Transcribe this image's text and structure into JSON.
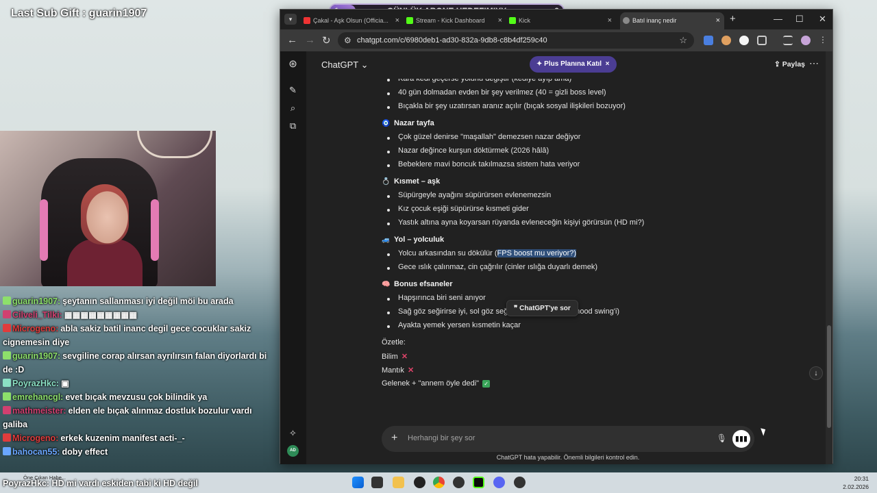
{
  "overlay": {
    "last_sub": "Last Sub Gift : guarin1907",
    "goal_title": "GÜNLÜK ABONE HEDEFIMIYY",
    "goal_current": "1",
    "goal_target": "9",
    "goal_progress": 0.11
  },
  "stream_chat": [
    {
      "user": "guarin1907:",
      "text": "şeytanın sallanması iyi değil möi bu arada",
      "color": "#8de06b"
    },
    {
      "user": "Cilveli_Tilki:",
      "text": "▦▦▦▦▦▦▦▦▦",
      "color": "#d14070"
    },
    {
      "user": "Microgeno:",
      "text": "abla sakiz batil inanc degil gece cocuklar sakiz cignemesin diye",
      "color": "#e03c3c"
    },
    {
      "user": "guarin1907:",
      "text": "sevgiline corap alırsan ayrılırsın falan diyorlardı bi de :D",
      "color": "#8de06b"
    },
    {
      "user": "PoyrazHkc:",
      "text": "▣",
      "color": "#8be0c4"
    },
    {
      "user": "emrehancgl:",
      "text": "evet bıçak mevzusu çok bilindik ya",
      "color": "#8de06b"
    },
    {
      "user": "mathmeister:",
      "text": "elden ele bıçak alınmaz dostluk bozulur vardı galiba",
      "color": "#d14070"
    },
    {
      "user": "Microgeno:",
      "text": "erkek kuzenim manifest acti-_-",
      "color": "#e03c3c"
    },
    {
      "user": "bahocan55:",
      "text": "doby effect",
      "color": "#6aa6ff"
    }
  ],
  "ticker": "PoyrazHkc: HD mi vardı eskiden tabi ki HD değil",
  "browser": {
    "tabs": [
      {
        "label": "Çakal - Aşk Olsun (Officia...",
        "color": "#e33"
      },
      {
        "label": "Stream - Kick Dashboard",
        "color": "#53fc18"
      },
      {
        "label": "Kick",
        "color": "#53fc18"
      },
      {
        "label": "Batıl inanç nedir",
        "color": "#8a8a8a"
      }
    ],
    "url": "chatgpt.com/c/6980deb1-ad30-832a-9db8-c8b4df259c40"
  },
  "chatgpt": {
    "model": "ChatGPT",
    "upgrade": "Plus Planına Katıl",
    "share": "Paylaş",
    "tooltip": "ChatGPT'ye sor",
    "composer_placeholder": "Herhangi bir şey sor",
    "disclaimer": "ChatGPT hata yapabilir. Önemli bilgileri kontrol edin.",
    "lines": [
      {
        "kind": "bullet",
        "text": "Kara kedi geçerse yolunu değiştir (kediye ayıp ama)"
      },
      {
        "kind": "bullet",
        "text": "40 gün dolmadan evden bir şey verilmez (40 = gizli boss level)"
      },
      {
        "kind": "bullet",
        "text": "Bıçakla bir şey uzatırsan aranız açılır (bıçak sosyal ilişkileri bozuyor)"
      },
      {
        "kind": "heading",
        "icon": "🧿",
        "text": "Nazar tayfa"
      },
      {
        "kind": "bullet",
        "text": "Çok güzel denirse \"maşallah\" demezsen nazar değiyor"
      },
      {
        "kind": "bullet",
        "text": "Nazar değince kurşun döktürmek (2026 hâlâ)"
      },
      {
        "kind": "bullet",
        "text": "Bebeklere mavi boncuk takılmazsa sistem hata veriyor"
      },
      {
        "kind": "heading",
        "icon": "💍",
        "text": "Kısmet – aşk"
      },
      {
        "kind": "bullet",
        "text": "Süpürgeyle ayağını süpürürsen evlenemezsin"
      },
      {
        "kind": "bullet",
        "text": "Kız çocuk eşiği süpürürse kısmeti gider"
      },
      {
        "kind": "bullet",
        "text": "Yastık altına ayna koyarsan rüyanda evleneceğin kişiyi görürsün (HD mi?)"
      },
      {
        "kind": "heading",
        "icon": "🚙",
        "text": "Yol – yolculuk"
      },
      {
        "kind": "bullet",
        "text": "Yolcu arkasından su dökülür (",
        "selected": "FPS boost mu veriyor?)"
      },
      {
        "kind": "bullet",
        "text": "Gece ıslık çalınmaz, cin çağrılır (cinler ıslığa duyarlı demek)"
      },
      {
        "kind": "heading",
        "icon": "🧠",
        "text": "Bonus efsaneler"
      },
      {
        "kind": "bullet",
        "text": "Hapşırınca biri seni anıyor"
      },
      {
        "kind": "bullet",
        "text": "Sağ göz seğirirse iyi, sol göz seğirirse kötü (gözlerin mood swing'i)"
      },
      {
        "kind": "bullet",
        "text": "Ayakta yemek yersen kısmetin kaçar"
      },
      {
        "kind": "plain",
        "text": "Özetle:"
      },
      {
        "kind": "plain",
        "text": "Bilim",
        "mark": "✕"
      },
      {
        "kind": "plain",
        "text": "Mantık",
        "mark": "✕"
      },
      {
        "kind": "plain",
        "text": "Gelenek + \"annem öyle dedi\"",
        "mark": "✓"
      }
    ]
  },
  "taskbar": {
    "news_label": "Öne Çıkan Habe...",
    "time": "20:31",
    "date": "2.02.2026"
  }
}
